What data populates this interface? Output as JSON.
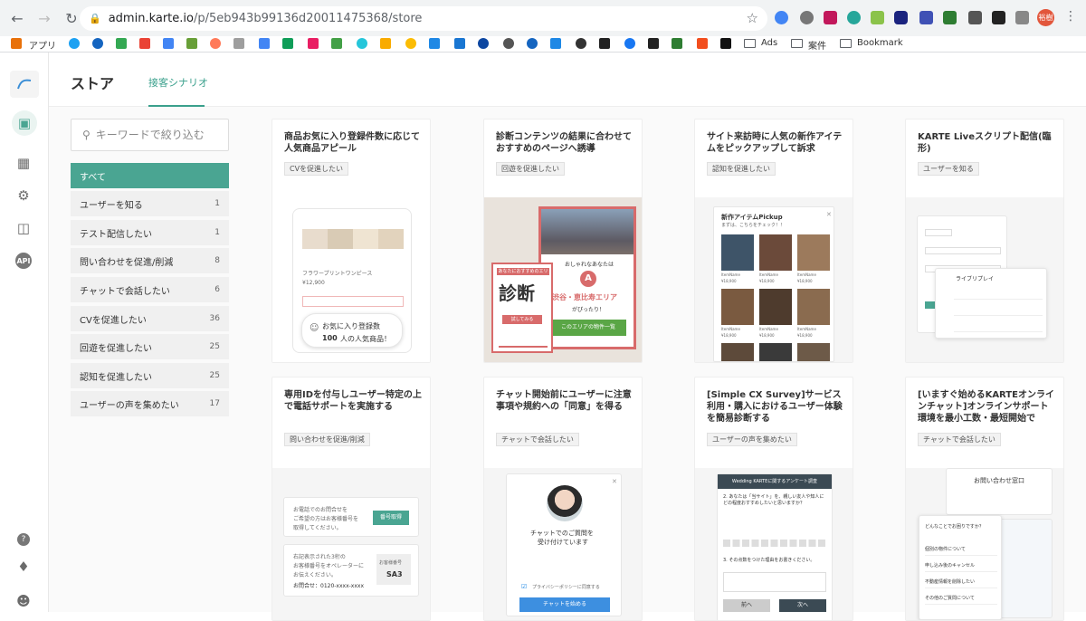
{
  "browser": {
    "url_host": "admin.karte.io",
    "url_path": "/p/5eb943b99136d20011475368/store",
    "profile_label": "裕樹",
    "bookmarks": {
      "apps": "アプリ",
      "folders": [
        "Ads",
        "案件",
        "Bookmark"
      ]
    }
  },
  "header": {
    "title": "ストア",
    "tab": "接客シナリオ"
  },
  "search": {
    "placeholder": "キーワードで絞り込む"
  },
  "categories": [
    {
      "label": "すべて",
      "count": ""
    },
    {
      "label": "ユーザーを知る",
      "count": "1"
    },
    {
      "label": "テスト配信したい",
      "count": "1"
    },
    {
      "label": "問い合わせを促進/削減",
      "count": "8"
    },
    {
      "label": "チャットで会話したい",
      "count": "6"
    },
    {
      "label": "CVを促進したい",
      "count": "36"
    },
    {
      "label": "回遊を促進したい",
      "count": "25"
    },
    {
      "label": "認知を促進したい",
      "count": "25"
    },
    {
      "label": "ユーザーの声を集めたい",
      "count": "17"
    }
  ],
  "cards": [
    {
      "title": "商品お気に入り登録件数に応じて人気商品アピール",
      "tag": "CVを促進したい"
    },
    {
      "title": "診断コンテンツの結果に合わせておすすめのページへ誘導",
      "tag": "回遊を促進したい"
    },
    {
      "title": "サイト来訪時に人気の新作アイテムをピックアップして訴求",
      "tag": "認知を促進したい"
    },
    {
      "title": "KARTE Liveスクリプト配信(臨形)",
      "tag": "ユーザーを知る"
    },
    {
      "title": "専用IDを付与しユーザー特定の上で電話サポートを実施する",
      "tag": "問い合わせを促進/削減"
    },
    {
      "title": "チャット開始前にユーザーに注意事項や規約への「同意」を得る",
      "tag": "チャットで会話したい"
    },
    {
      "title": "[Simple CX Survey]サービス利用・購入におけるユーザー体験を簡易診断する",
      "tag": "ユーザーの声を集めたい"
    },
    {
      "title": "[いますぐ始めるKARTEオンラインチャット]オンラインサポート環境を最小工数・最短開始で",
      "tag": "チャットで会話したい"
    }
  ],
  "previews": {
    "fav": {
      "product": "フラワープリントワンピース",
      "price": "¥12,900",
      "line1": "お気に入り登録数",
      "count": "100",
      "line2": "人の人気商品！"
    },
    "diag": {
      "small": "あなたにおすすめのエリア",
      "big": "診断",
      "sub": "おしゃれなあなたは",
      "badge": "A",
      "area": "渋谷・恵比寿エリア",
      "ending": "がぴったり！",
      "button": "このエリアの物件一覧",
      "try": "試してみる"
    },
    "pickup": {
      "title": "新作アイテムPickup",
      "sub": "まずは、こちらをチェック！！",
      "item": "ItemName",
      "price": "¥18,900"
    },
    "live": {
      "title": "ライブリプレイ"
    },
    "phone": {
      "text1": "お電話でのお問合せを",
      "text2": "ご希望の方はお客様番号を",
      "text3": "取得してください。",
      "btn": "番号取得",
      "text4": "右記表示された3桁の",
      "text5": "お客様番号をオペレーターに",
      "text6": "お伝えください。",
      "tel": "お問合せ：0120-xxxx-xxxx",
      "box_label": "お客様番号",
      "code": "SA3"
    },
    "consent": {
      "head1": "チャットでのご質問を",
      "head2": "受け付けています",
      "check": "プライバシーポリシーに同意する",
      "btn": "チャットを始める"
    },
    "survey": {
      "head": "Wedding KARTEに関するアンケート調査",
      "q1": "2. あなたは「当サイト」を、親しい友人や知人にどの程度おすすめしたいと思いますか？",
      "q2": "3. その点数をつけた理由をお書きください。",
      "back": "前へ",
      "next": "次へ"
    },
    "online": {
      "head": "お問い合わせ窓口",
      "q": "どんなことでお困りですか？",
      "items": [
        "個別の物件について",
        "申し込み後のキャンセル",
        "不動産情報を削除したい",
        "その他のご質問について"
      ]
    }
  }
}
